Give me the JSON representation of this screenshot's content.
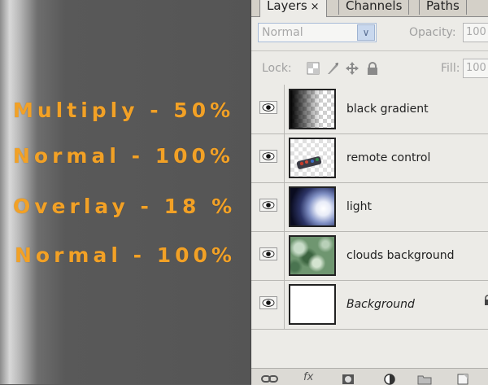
{
  "annotations": [
    {
      "text": "Multiply - 50%"
    },
    {
      "text": "Normal - 100%"
    },
    {
      "text": "Overlay - 18 %"
    },
    {
      "text": "Normal - 100%"
    }
  ],
  "tabs": [
    {
      "label": "Layers",
      "close": "×"
    },
    {
      "label": "Channels"
    },
    {
      "label": "Paths"
    }
  ],
  "blend_mode": {
    "value": "Normal",
    "arrow": "∨"
  },
  "opacity": {
    "label": "Opacity:",
    "value": "100"
  },
  "lock": {
    "label": "Lock:"
  },
  "fill": {
    "label": "Fill:",
    "value": "100"
  },
  "layers": [
    {
      "name": "black gradient",
      "thumb": "gradient"
    },
    {
      "name": "remote control",
      "thumb": "remote"
    },
    {
      "name": "light",
      "thumb": "light"
    },
    {
      "name": "clouds background",
      "thumb": "clouds"
    },
    {
      "name": "Background",
      "thumb": "white",
      "italic": true
    }
  ],
  "footer_icons": [
    "link-layers-icon",
    "fx-icon",
    "mask-icon",
    "adjustment-layer-icon",
    "group-folder-icon",
    "new-layer-icon"
  ],
  "colors": {
    "annotation": "#f2a126",
    "panel_bg": "#ecebe7"
  }
}
